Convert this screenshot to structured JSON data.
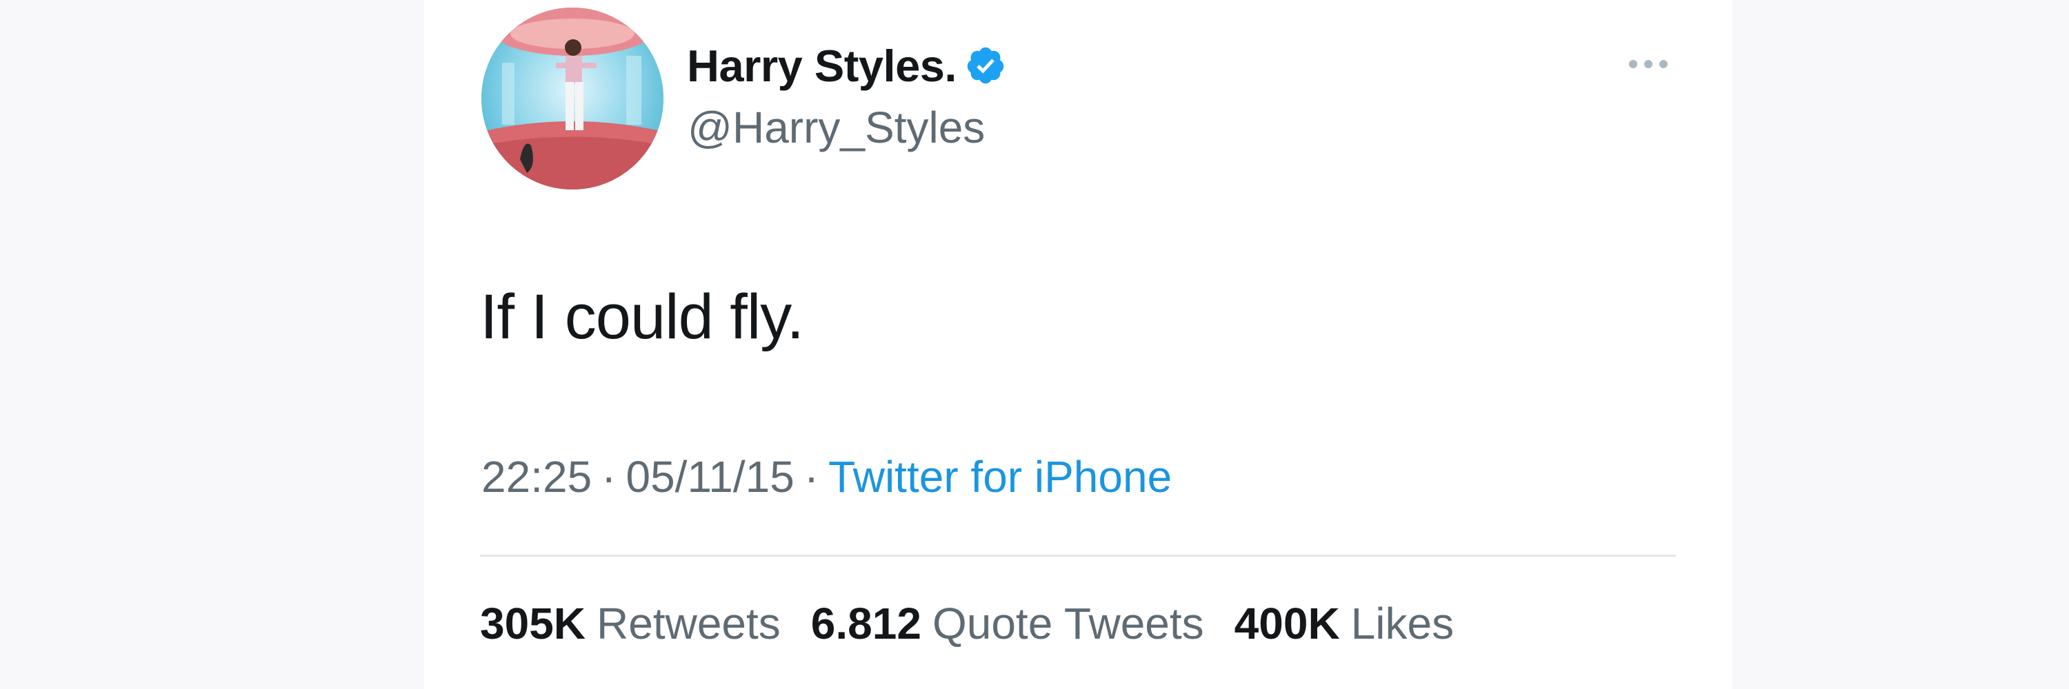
{
  "tweet": {
    "author": {
      "display_name": "Harry Styles.",
      "handle": "@Harry_Styles",
      "verified": true,
      "avatar_icon": "avatar-photo"
    },
    "text": "If I could fly.",
    "time": "22:25",
    "date": "05/11/15",
    "separator": "·",
    "source": "Twitter for iPhone",
    "stats": {
      "retweets_count": "305K",
      "retweets_label": "Retweets",
      "quotes_count": "6.812",
      "quotes_label": "Quote Tweets",
      "likes_count": "400K",
      "likes_label": "Likes"
    },
    "more_icon": "more-dots-icon"
  },
  "colors": {
    "link": "#1b95e0",
    "verified": "#1da1f2",
    "text_primary": "#14171a",
    "text_secondary": "#5f6b74",
    "divider": "#e3e6e8"
  }
}
